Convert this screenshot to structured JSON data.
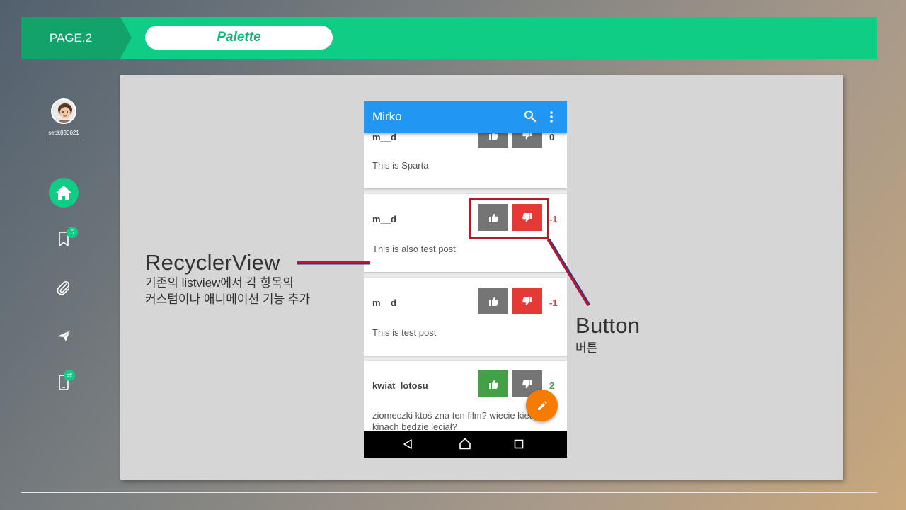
{
  "header": {
    "page_label": "PAGE.2",
    "title": "Palette"
  },
  "sidebar": {
    "username": "seok830621",
    "bookmark_badge": "5",
    "phone_badge": "off",
    "items": [
      {
        "icon": "home-icon",
        "active": true
      },
      {
        "icon": "bookmark-icon"
      },
      {
        "icon": "paperclip-icon"
      },
      {
        "icon": "send-icon"
      },
      {
        "icon": "phone-icon"
      }
    ]
  },
  "phone": {
    "app_title": "Mirko",
    "posts": [
      {
        "user": "m__d",
        "text": "This is Sparta",
        "score": "0",
        "vote": "none"
      },
      {
        "user": "m__d",
        "text": "This is also test post",
        "score": "-1",
        "vote": "down"
      },
      {
        "user": "m__d",
        "text": "This is test post",
        "score": "-1",
        "vote": "down"
      },
      {
        "user": "kwiat_lotosu",
        "text": "ziomeczki ktoś zna ten film? wiecie kiedy kinach będzie leciał?",
        "score": "2",
        "vote": "up"
      }
    ]
  },
  "annotations": {
    "recycler": {
      "title": "RecyclerView",
      "line1": "기존의 listview에서 각 항목의",
      "line2": "커스텀이나 애니메이션 기능 추가"
    },
    "button": {
      "title": "Button",
      "subtitle": "버튼"
    }
  },
  "colors": {
    "accent_green": "#10cd86",
    "appbar_blue": "#2196f3",
    "downvote_red": "#e53935",
    "upvote_green": "#43a047",
    "fab_orange": "#f57c00",
    "annotation_red": "#b01c2e"
  }
}
